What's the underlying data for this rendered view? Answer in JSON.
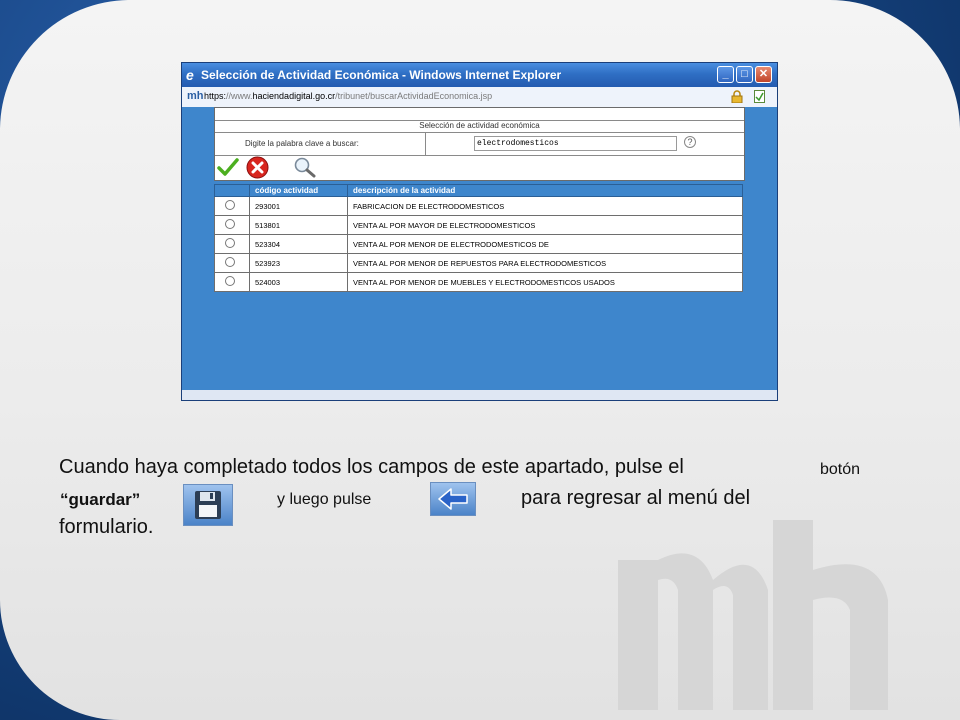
{
  "window": {
    "title": "Selección de Actividad Económica - Windows Internet Explorer",
    "minimize": "_",
    "maximize": "□",
    "close": "✕"
  },
  "address": {
    "scheme": "https:",
    "url_prefix": "//www.",
    "url_host": "haciendadigital.go.cr",
    "url_path": "/tribunet/buscarActividadEconomica.jsp"
  },
  "form": {
    "heading": "Selección de actividad económica",
    "label": "Digite la palabra clave a buscar:",
    "search_value": "electrodomesticos",
    "help": "?"
  },
  "table": {
    "headers": [
      "código actividad",
      "descripción de la actividad"
    ],
    "rows": [
      {
        "code": "293001",
        "desc": "FABRICACION DE ELECTRODOMESTICOS"
      },
      {
        "code": "513801",
        "desc": "VENTA AL POR MAYOR DE ELECTRODOMESTICOS"
      },
      {
        "code": "523304",
        "desc": "VENTA AL POR MENOR DE ELECTRODOMESTICOS DE"
      },
      {
        "code": "523923",
        "desc": "VENTA AL POR MENOR DE REPUESTOS PARA ELECTRODOMESTICOS"
      },
      {
        "code": "524003",
        "desc": "VENTA AL POR MENOR DE MUEBLES Y ELECTRODOMESTICOS USADOS"
      }
    ]
  },
  "instructions": {
    "line1": "Cuando haya completado todos los campos de este apartado, pulse el",
    "boton": "botón",
    "guardar": "“guardar”",
    "luego": "y luego pulse",
    "regresar": "para  regresar al menú del",
    "formulario": "formulario."
  },
  "icons": {
    "ie": "ie-logo-icon",
    "lock": "lock-icon",
    "check": "check-icon",
    "cancel": "cancel-icon",
    "search": "magnifier-icon",
    "save": "floppy-disk-icon",
    "back": "back-arrow-icon"
  },
  "colors": {
    "titlebar": "#2f6fc4",
    "content_bg": "#3e86cc",
    "slide_border": "#1f4f8f"
  }
}
